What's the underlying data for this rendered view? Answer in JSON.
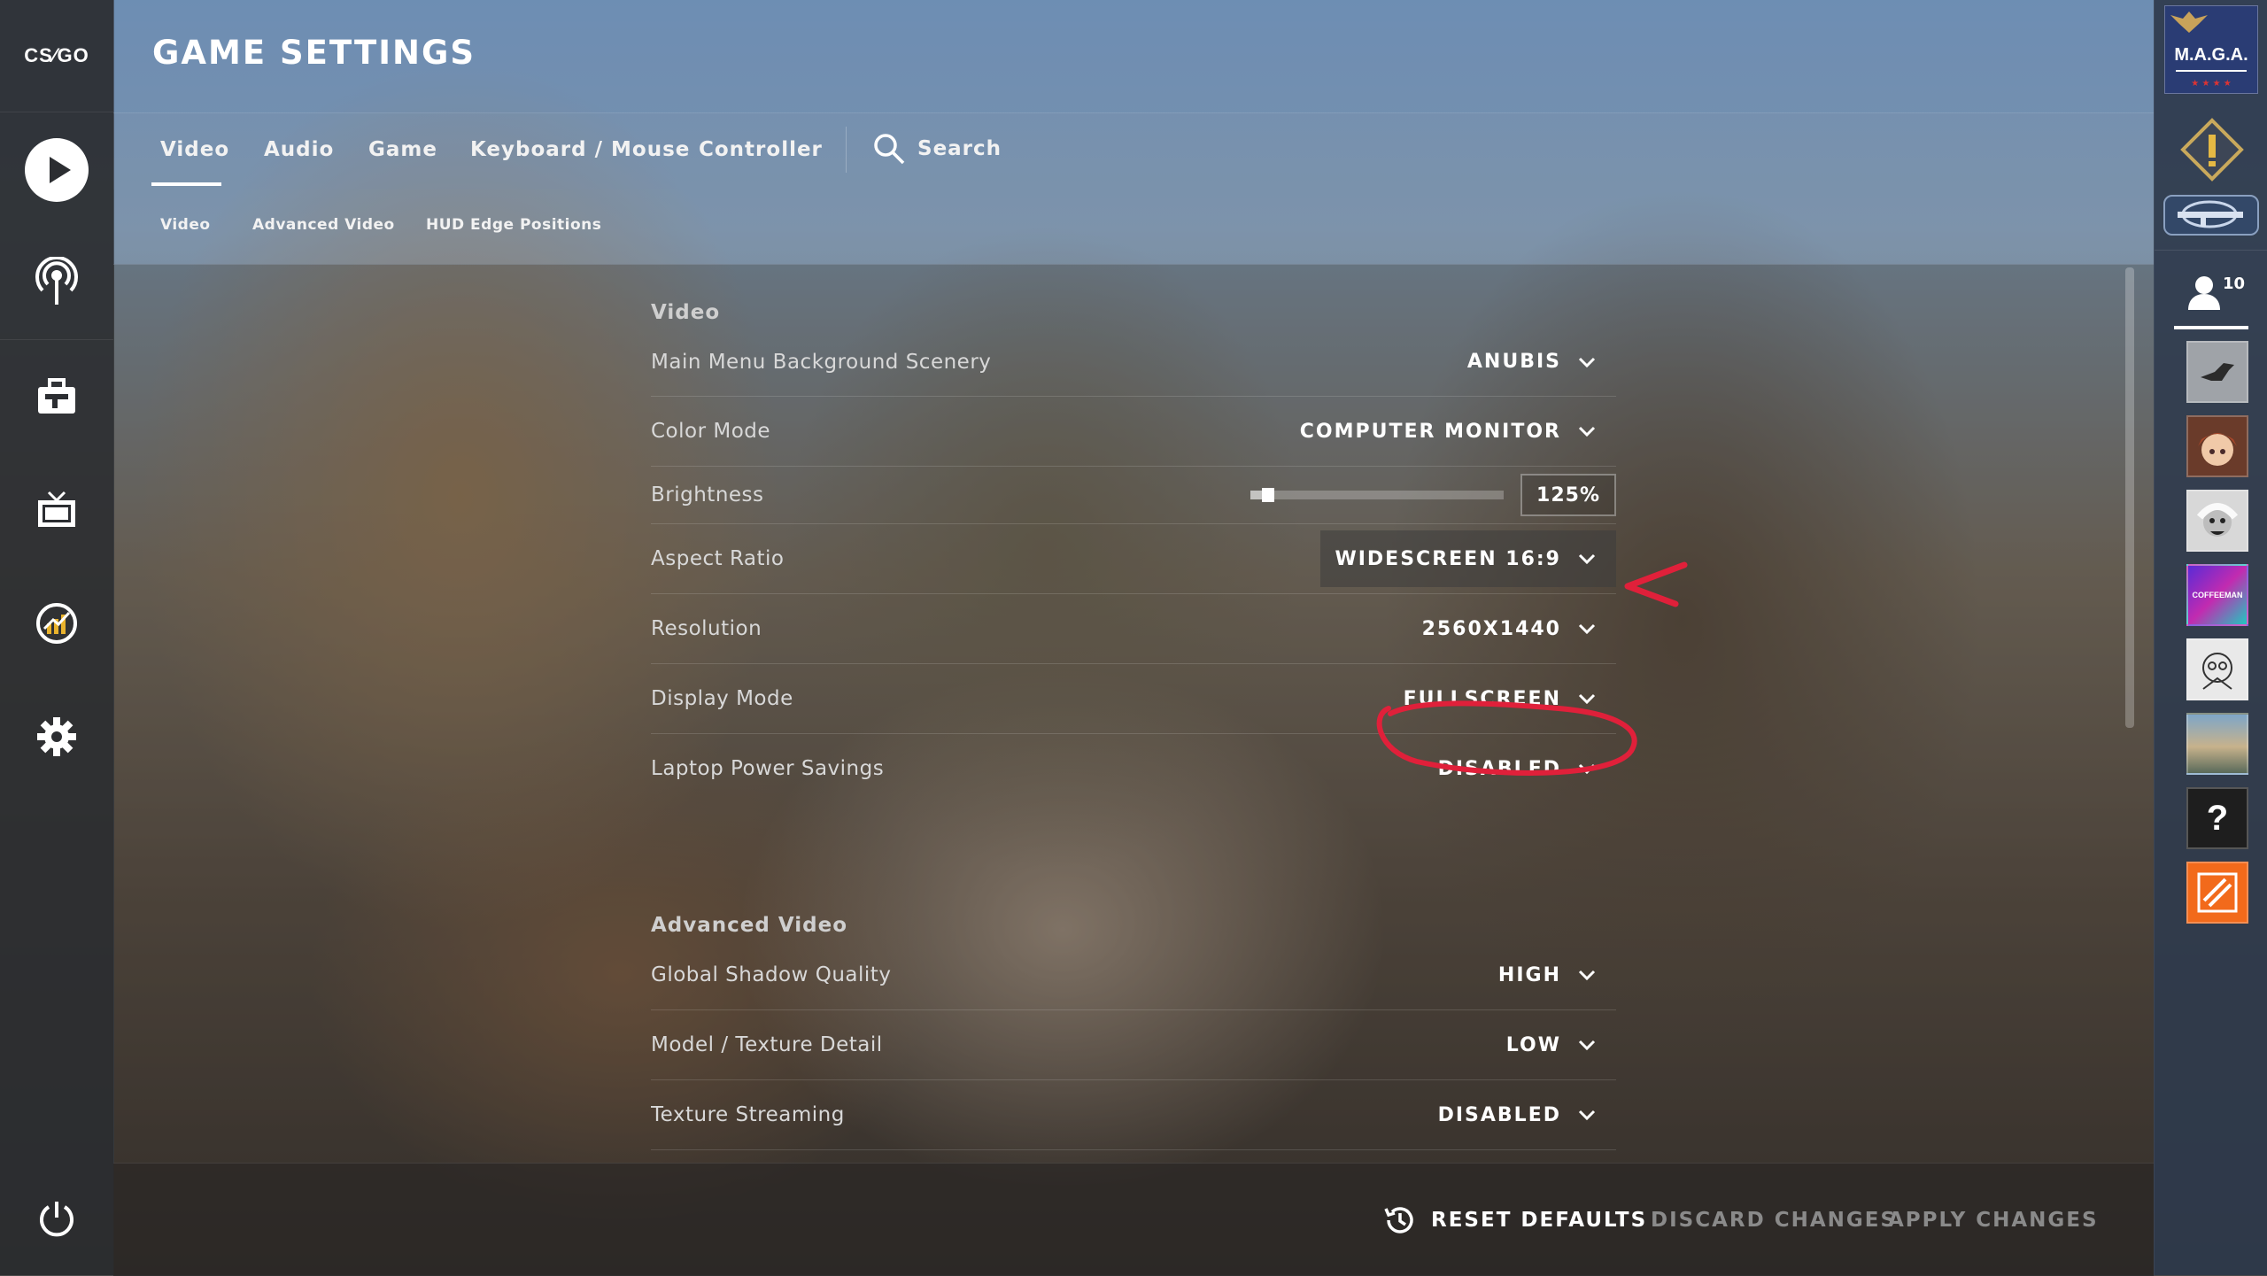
{
  "app": {
    "logo_text": "CS⁄GO"
  },
  "header": {
    "title": "GAME SETTINGS"
  },
  "tabs": [
    {
      "label": "Video",
      "active": true
    },
    {
      "label": "Audio"
    },
    {
      "label": "Game"
    },
    {
      "label": "Keyboard / Mouse"
    },
    {
      "label": "Controller"
    }
  ],
  "search": {
    "label": "Search",
    "icon": "search-icon"
  },
  "subtabs": [
    {
      "label": "Video"
    },
    {
      "label": "Advanced Video"
    },
    {
      "label": "HUD Edge Positions"
    }
  ],
  "leftnav": {
    "items": [
      {
        "name": "play-button",
        "icon": "play-icon"
      },
      {
        "name": "watch-broadcast-button",
        "icon": "antenna-icon"
      },
      {
        "name": "inventory-button",
        "icon": "briefcase-icon"
      },
      {
        "name": "watch-button",
        "icon": "tv-icon"
      },
      {
        "name": "stats-button",
        "icon": "stats-icon"
      },
      {
        "name": "settings-button",
        "icon": "gear-icon"
      },
      {
        "name": "power-button",
        "icon": "power-icon"
      }
    ]
  },
  "video": {
    "section_title": "Video",
    "rows": [
      {
        "label": "Main Menu Background Scenery",
        "value": "ANUBIS"
      },
      {
        "label": "Color Mode",
        "value": "COMPUTER MONITOR"
      },
      {
        "label": "Brightness",
        "value": "125%",
        "slider_fraction": 0.07
      },
      {
        "label": "Aspect Ratio",
        "value": "WIDESCREEN 16:9"
      },
      {
        "label": "Resolution",
        "value": "2560X1440"
      },
      {
        "label": "Display Mode",
        "value": "FULLSCREEN"
      },
      {
        "label": "Laptop Power Savings",
        "value": "DISABLED"
      }
    ]
  },
  "advanced_video": {
    "section_title": "Advanced Video",
    "rows": [
      {
        "label": "Global Shadow Quality",
        "value": "HIGH"
      },
      {
        "label": "Model / Texture Detail",
        "value": "LOW"
      },
      {
        "label": "Texture Streaming",
        "value": "DISABLED"
      }
    ]
  },
  "footer": {
    "reset_label": "RESET DEFAULTS",
    "discard_label": "DISCARD CHANGES",
    "apply_label": "APPLY CHANGES"
  },
  "right_panel": {
    "badge_text": "M.A.G.A.",
    "friends_count": "10",
    "avatars": [
      {
        "name": "avatar-crow"
      },
      {
        "name": "avatar-anime"
      },
      {
        "name": "avatar-einstein"
      },
      {
        "name": "avatar-coffeeman",
        "text": "COFFEEMAN"
      },
      {
        "name": "avatar-sketch"
      },
      {
        "name": "avatar-landscape"
      },
      {
        "name": "avatar-unknown",
        "text": "?"
      },
      {
        "name": "avatar-homedepot"
      }
    ]
  },
  "colors": {
    "annotation_red": "#e0203a",
    "disabled_text": "#8a8a8a",
    "coffeeman_gradient": [
      "#5a2bd6",
      "#21c7c0"
    ],
    "homedepot_orange": "#f26a1b"
  }
}
